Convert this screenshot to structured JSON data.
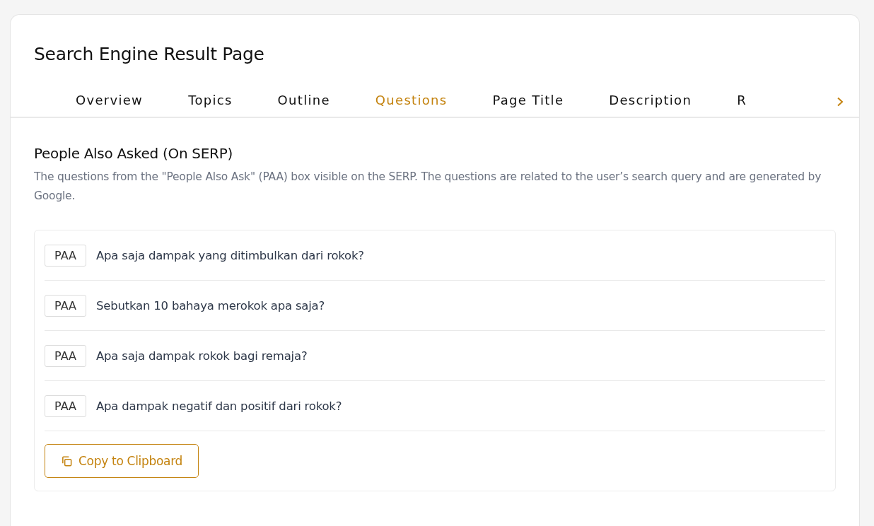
{
  "page": {
    "title": "Search Engine Result Page"
  },
  "tabs": [
    {
      "label": "Overview",
      "selected": false
    },
    {
      "label": "Topics",
      "selected": false
    },
    {
      "label": "Outline",
      "selected": false
    },
    {
      "label": "Questions",
      "selected": true
    },
    {
      "label": "Page Title",
      "selected": false
    },
    {
      "label": "Description",
      "selected": false
    },
    {
      "label": "R",
      "selected": false
    }
  ],
  "section": {
    "heading": "People Also Asked (On SERP)",
    "description": "The questions from the \"People Also Ask\" (PAA) box visible on the SERP. The questions are related to the user’s search query and are generated by Google."
  },
  "questions": [
    {
      "badge": "PAA",
      "text": "Apa saja dampak yang ditimbulkan dari rokok?"
    },
    {
      "badge": "PAA",
      "text": "Sebutkan 10 bahaya merokok apa saja?"
    },
    {
      "badge": "PAA",
      "text": "Apa saja dampak rokok bagi remaja?"
    },
    {
      "badge": "PAA",
      "text": "Apa dampak negatif dan positif dari rokok?"
    }
  ],
  "copy_button": {
    "label": "Copy to Clipboard"
  }
}
